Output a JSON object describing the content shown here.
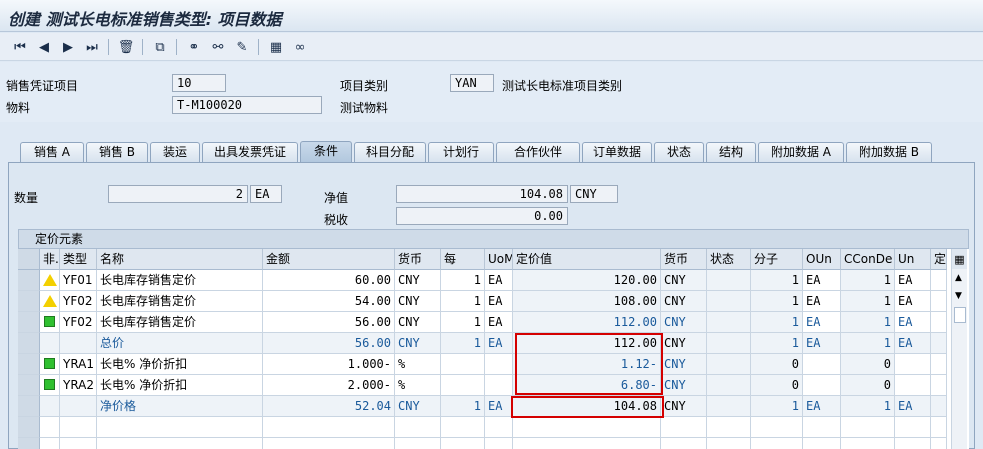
{
  "window": {
    "title": "创建 测试长电标准销售类型: 项目数据"
  },
  "toolbar": {
    "icons": [
      "first-page-icon",
      "prev-page-icon",
      "next-page-icon",
      "last-page-icon",
      "delete-icon",
      "copy-icon",
      "partner-icon",
      "partner2-icon",
      "edit-icon",
      "calculator-icon",
      "glasses-icon"
    ]
  },
  "header": {
    "item_label": "销售凭证项目",
    "item_value": "10",
    "item_cat_label": "项目类别",
    "item_cat_value": "YAN",
    "item_cat_desc": "测试长电标准项目类别",
    "material_label": "物料",
    "material_value": "T-M100020",
    "material_desc": "测试物料"
  },
  "tabs": [
    "销售 A",
    "销售 B",
    "装运",
    "出具发票凭证",
    "条件",
    "科目分配",
    "计划行",
    "合作伙伴",
    "订单数据",
    "状态",
    "结构",
    "附加数据 A",
    "附加数据 B"
  ],
  "active_tab": "条件",
  "summary": {
    "qty_label": "数量",
    "qty_value": "2",
    "qty_unit": "EA",
    "net_label": "净值",
    "net_value": "104.08",
    "net_currency": "CNY",
    "tax_label": "税收",
    "tax_value": "0.00"
  },
  "pricing": {
    "title": "定价元素",
    "columns": [
      "非.",
      "类型",
      "名称",
      "金额",
      "货币",
      "每",
      "UoM",
      "定价值",
      "货币",
      "状态",
      "分子",
      "OUn",
      "CConDe",
      "Un",
      "定价"
    ],
    "rows": [
      {
        "status": "yellow",
        "type": "YF01",
        "name": "长电库存销售定价",
        "amount": "60.00",
        "curr": "CNY",
        "per": "1",
        "uom": "EA",
        "value": "120.00",
        "vcurr": "CNY",
        "num": "1",
        "oun": "EA",
        "ccon": "1",
        "un": "EA",
        "total": false
      },
      {
        "status": "yellow",
        "type": "YF02",
        "name": "长电库存销售定价",
        "amount": "54.00",
        "curr": "CNY",
        "per": "1",
        "uom": "EA",
        "value": "108.00",
        "vcurr": "CNY",
        "num": "1",
        "oun": "EA",
        "ccon": "1",
        "un": "EA",
        "total": false
      },
      {
        "status": "green",
        "type": "YF02",
        "name": "长电库存销售定价",
        "amount": "56.00",
        "curr": "CNY",
        "per": "1",
        "uom": "EA",
        "value": "112.00",
        "vcurr": "CNY",
        "num": "1",
        "oun": "EA",
        "ccon": "1",
        "un": "EA",
        "total": false,
        "bluevalue": true
      },
      {
        "status": "",
        "type": "",
        "name": "总价",
        "amount": "56.00",
        "curr": "CNY",
        "per": "1",
        "uom": "EA",
        "value": "112.00",
        "vcurr": "CNY",
        "num": "1",
        "oun": "EA",
        "ccon": "1",
        "un": "EA",
        "total": true
      },
      {
        "status": "green",
        "type": "YRA1",
        "name": "长电% 净价折扣",
        "amount": "1.000-",
        "curr": "%",
        "per": "",
        "uom": "",
        "value": "1.12-",
        "vcurr": "CNY",
        "num": "0",
        "oun": "",
        "ccon": "0",
        "un": "",
        "total": false,
        "bluevalue": true
      },
      {
        "status": "green",
        "type": "YRA2",
        "name": "长电% 净价折扣",
        "amount": "2.000-",
        "curr": "%",
        "per": "",
        "uom": "",
        "value": "6.80-",
        "vcurr": "CNY",
        "num": "0",
        "oun": "",
        "ccon": "0",
        "un": "",
        "total": false,
        "bluevalue": true
      },
      {
        "status": "",
        "type": "",
        "name": "净价格",
        "amount": "52.04",
        "curr": "CNY",
        "per": "1",
        "uom": "EA",
        "value": "104.08",
        "vcurr": "CNY",
        "num": "1",
        "oun": "EA",
        "ccon": "1",
        "un": "EA",
        "total": true
      }
    ]
  },
  "colors": {
    "red_highlight": "#d40000",
    "blue_text": "#1a5a9b",
    "green_status": "#30c030",
    "yellow_status": "#f3d000"
  }
}
